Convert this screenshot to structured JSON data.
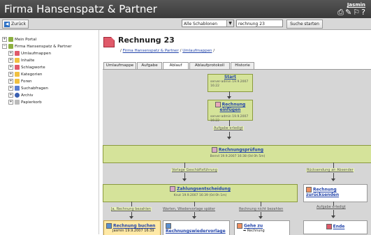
{
  "app": {
    "title": "Firma Hansenspatz & Partner",
    "user": "Jasmin",
    "icons": "⎙✎⚐?"
  },
  "toolbar": {
    "back_label": "Zurück",
    "template_select": "Alle Schablonen",
    "search_value": "rechnung 23",
    "search_button": "Suche starten"
  },
  "tree": {
    "items": [
      {
        "label": "Mein Portal",
        "color": "#8cb040"
      },
      {
        "label": "Firma Hansenspatz & Partner",
        "color": "#8cb040"
      },
      {
        "label": "Umlaufmappen",
        "color": "#e05a6a"
      },
      {
        "label": "Inhalte",
        "color": "#f0c040"
      },
      {
        "label": "Schlagworte",
        "color": "#e05a6a"
      },
      {
        "label": "Kategorien",
        "color": "#f0c040"
      },
      {
        "label": "Foren",
        "color": "#f0c040"
      },
      {
        "label": "Suchabfragen",
        "color": "#5a7fd0"
      },
      {
        "label": "Archiv",
        "color": "#3a5fb0"
      },
      {
        "label": "Papierkorb",
        "color": "#bbbbbb"
      }
    ]
  },
  "page": {
    "title": "Rechnung 23",
    "breadcrumb": [
      "Firma Hansenspatz & Partner",
      "Umlaufmappen"
    ]
  },
  "tabs": [
    "Umlaufmappe",
    "Aufgabe",
    "Ablauf",
    "Ablaufprotokoll",
    "Historie"
  ],
  "flow": {
    "start": {
      "title": "Start",
      "user": "server-admin",
      "date": "19.9.2007 16:22"
    },
    "einfuegen": {
      "title": "Rechnung einfügen",
      "user": "server-admin",
      "date": "19.9.2007 16:22"
    },
    "aufgabe_erledigt": "Aufgabe erledigt",
    "pruefung": {
      "title": "Rechnungsprüfung",
      "user": "Bernd",
      "date": "19.9.2007 16:38 (0d 0h 5m)"
    },
    "vorlage_gf": "Vorlage Geschäftsführung",
    "ruecksendung": "Rücksendung an Absender",
    "entscheidung": {
      "title": "Zahlungsentscheidung",
      "user": "Knut",
      "date": "19.9.2007 16:39 (0d 0h 1m)"
    },
    "zuruecksenden": "Rechnung zurücksenden",
    "aufgabe_erledigt2": "Aufgabe erledigt",
    "ende": "Ende",
    "opt1": "Ja, Rechnung bezahlen",
    "opt2": "Warten, Wiedervorlage später",
    "opt3": "Rechnung nicht bezahlen",
    "buchen": {
      "title": "Rechnung buchen",
      "user": "Jasmin",
      "date": "19.9.2007 16:39"
    },
    "wiedervorlage": "Rechnungswiedervorlage",
    "gehe_zu": "Gehe zu",
    "gehe_zu_sub": "Rechnung"
  }
}
